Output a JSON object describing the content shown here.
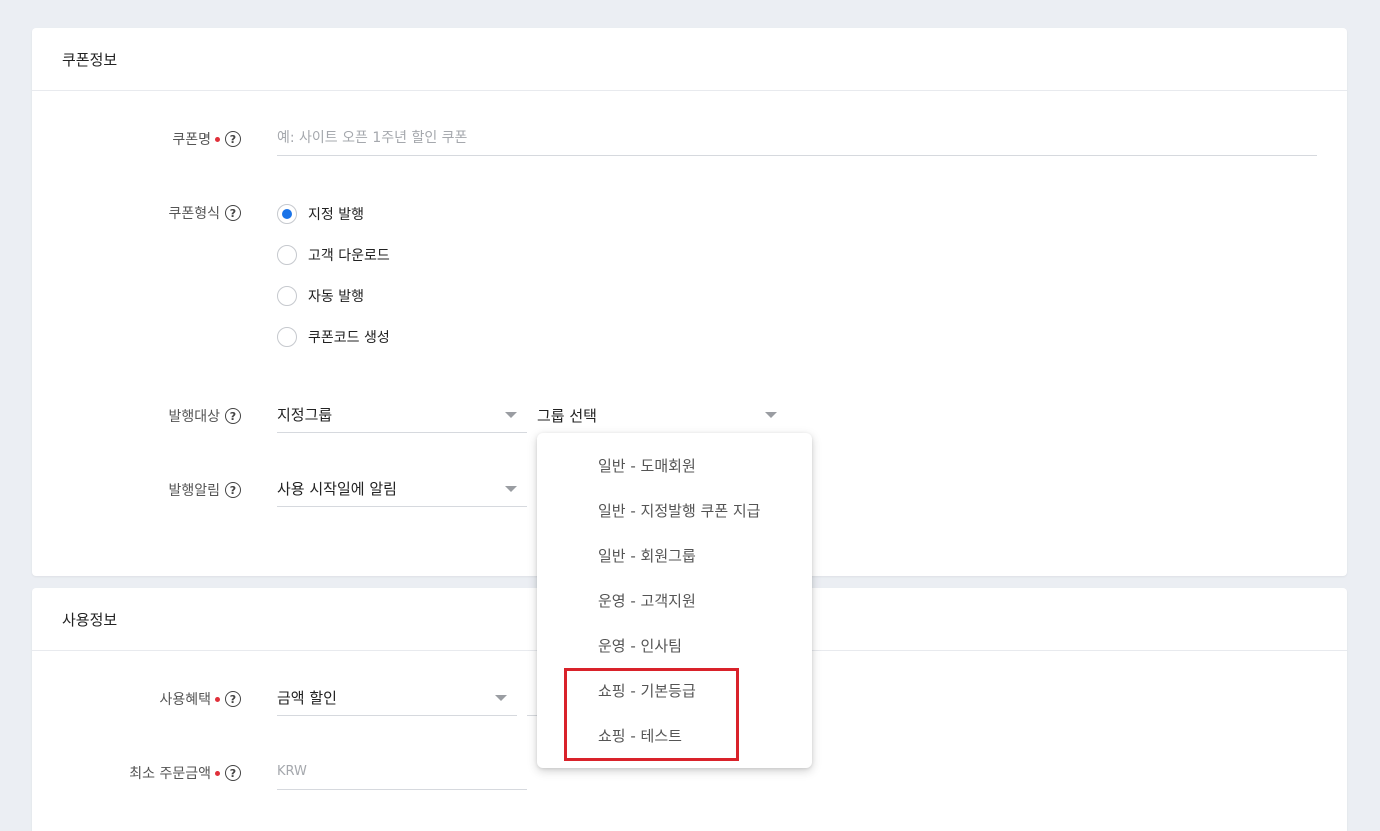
{
  "coupon_info": {
    "title": "쿠폰정보",
    "name_label": "쿠폰명",
    "name_placeholder": "예: 사이트 오픈 1주년 할인 쿠폰",
    "type_label": "쿠폰형식",
    "type_options": [
      "지정 발행",
      "고객 다운로드",
      "자동 발행",
      "쿠폰코드 생성"
    ],
    "type_selected_index": 0,
    "target_label": "발행대상",
    "target_value": "지정그룹",
    "group_value": "그룹 선택",
    "notify_label": "발행알림",
    "notify_value": "사용 시작일에 알림"
  },
  "group_dropdown": {
    "items": [
      "일반 - 도매회원",
      "일반 - 지정발행 쿠폰 지급",
      "일반 - 회원그룹",
      "운영 - 고객지원",
      "운영 - 인사팀",
      "쇼핑 - 기본등급",
      "쇼핑 - 테스트"
    ],
    "highlighted_items": [
      "쇼핑 - 기본등급",
      "쇼핑 - 테스트"
    ]
  },
  "usage_info": {
    "title": "사용정보",
    "benefit_label": "사용혜택",
    "benefit_value": "금액 할인",
    "min_order_label": "최소 주문금액",
    "min_order_placeholder": "KRW"
  },
  "colors": {
    "accent": "#1a73e8",
    "required": "#e0303a",
    "highlight": "#d9222a",
    "background": "#ebeef3"
  },
  "icons": {
    "help": "?"
  }
}
